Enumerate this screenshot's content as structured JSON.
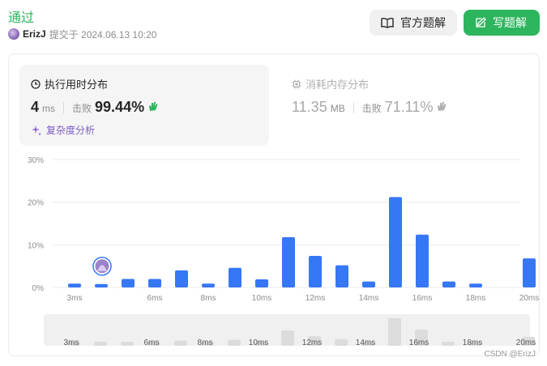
{
  "header": {
    "status": "通过",
    "user": "ErizJ",
    "submitted": "提交于 2024.06.13 10:20"
  },
  "buttons": {
    "solution": "官方题解",
    "write": "写题解"
  },
  "runtime": {
    "title": "执行用时分布",
    "value": "4",
    "unit": "ms",
    "beat_label": "击败",
    "beat": "99.44%",
    "complexity": "复杂度分析"
  },
  "memory": {
    "title": "消耗内存分布",
    "value": "11.35",
    "unit": "MB",
    "beat_label": "击败",
    "beat": "71.11%"
  },
  "colors": {
    "accent_green": "#2db55d",
    "bar_blue": "#3677f6",
    "purple": "#7c5cc4"
  },
  "chart_data": {
    "type": "bar",
    "categories": [
      "3ms",
      "4ms",
      "5ms",
      "6ms",
      "7ms",
      "8ms",
      "9ms",
      "10ms",
      "11ms",
      "12ms",
      "13ms",
      "14ms",
      "15ms",
      "16ms",
      "17ms",
      "18ms",
      "19ms",
      "20ms"
    ],
    "values": [
      0.9,
      0.8,
      2.0,
      2.0,
      4.0,
      0.9,
      4.6,
      1.9,
      11.8,
      7.4,
      5.2,
      1.4,
      21.2,
      12.4,
      1.4,
      0.9,
      0,
      6.8
    ],
    "x_tick_labels": [
      "3ms",
      "6ms",
      "8ms",
      "10ms",
      "12ms",
      "14ms",
      "16ms",
      "18ms",
      "20ms"
    ],
    "y_ticks": [
      "0%",
      "10%",
      "20%",
      "30%"
    ],
    "ylim": [
      0,
      30
    ],
    "grid": true,
    "highlight_category": "4ms",
    "overview": {
      "tick_labels": [
        "3ms",
        "6ms",
        "8ms",
        "10ms",
        "12ms",
        "14ms",
        "16ms",
        "18ms",
        "20ms"
      ]
    }
  },
  "watermark": "CSDN @ErizJ"
}
